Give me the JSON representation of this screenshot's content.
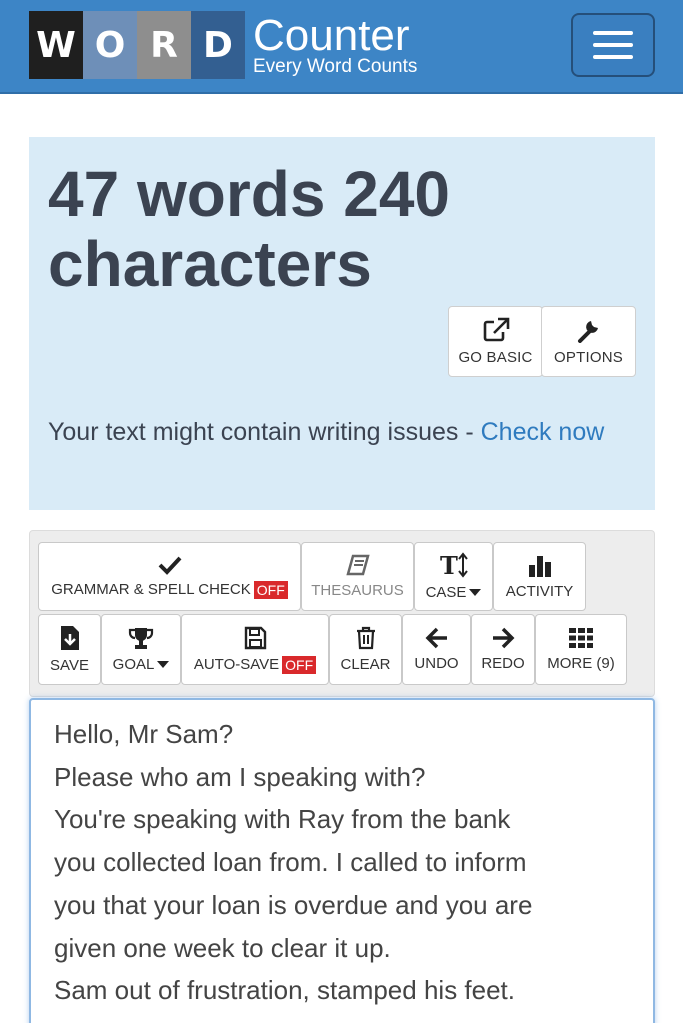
{
  "header": {
    "logo_letters": [
      "W",
      "O",
      "R",
      "D"
    ],
    "logo_word": "Counter",
    "logo_tagline": "Every Word Counts",
    "menu_icon": "hamburger-menu-icon"
  },
  "stats": {
    "title": "47 words 240 characters",
    "buttons": [
      {
        "label": "GO BASIC",
        "icon": "external-link-icon"
      },
      {
        "label": "OPTIONS",
        "icon": "wrench-icon"
      }
    ],
    "issues_text": "Your text might contain writing issues - ",
    "issues_link": "Check now"
  },
  "toolbar": {
    "grammar": {
      "label": "GRAMMAR & SPELL CHECK",
      "state": "OFF",
      "icon": "checkmark-icon"
    },
    "thesaurus": {
      "label": "THESAURUS",
      "icon": "book-icon"
    },
    "case": {
      "label": "CASE",
      "icon": "text-case-icon"
    },
    "activity": {
      "label": "ACTIVITY",
      "icon": "bar-chart-icon"
    },
    "save": {
      "label": "SAVE",
      "icon": "download-file-icon"
    },
    "goal": {
      "label": "GOAL",
      "icon": "trophy-icon"
    },
    "autosave": {
      "label": "AUTO-SAVE",
      "state": "OFF",
      "icon": "floppy-disk-icon"
    },
    "clear": {
      "label": "CLEAR",
      "icon": "trash-icon"
    },
    "undo": {
      "label": "UNDO",
      "icon": "arrow-left-icon"
    },
    "redo": {
      "label": "REDO",
      "icon": "arrow-right-icon"
    },
    "more": {
      "label": "MORE (9)",
      "icon": "grid-icon"
    }
  },
  "editor": {
    "lines": [
      "Hello, Mr Sam?",
      "Please who am I speaking with?",
      "You're speaking with Ray from the bank",
      "you collected loan from. I called to inform",
      "you that your loan is overdue and you are",
      "given one week to clear it up.",
      "Sam out of frustration, stamped his feet."
    ]
  },
  "colors": {
    "header_bg": "#3d85c6",
    "stats_bg": "#d9ebf7",
    "link": "#2f7bbf",
    "badge_off": "#d9292b"
  }
}
